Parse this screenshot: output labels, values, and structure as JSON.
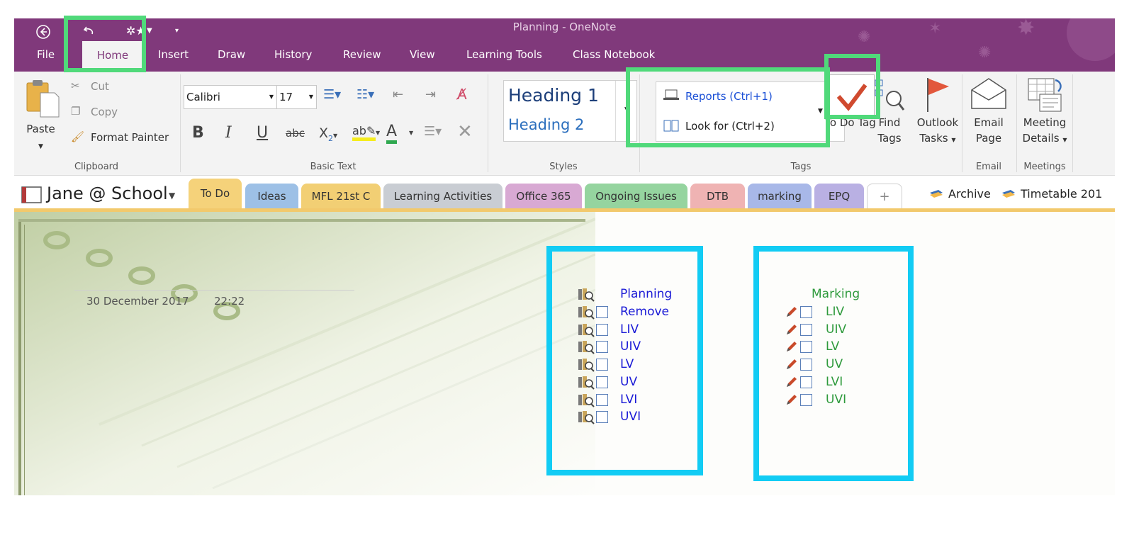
{
  "window": {
    "title": "Planning - OneNote"
  },
  "ribbon_tabs": [
    "File",
    "Home",
    "Insert",
    "Draw",
    "History",
    "Review",
    "View",
    "Learning Tools",
    "Class Notebook"
  ],
  "clipboard": {
    "paste": "Paste",
    "cut": "Cut",
    "copy": "Copy",
    "format_painter": "Format Painter",
    "group_label": "Clipboard"
  },
  "basic_text": {
    "font": "Calibri",
    "size": "17",
    "group_label": "Basic Text"
  },
  "styles": {
    "heading1": "Heading 1",
    "heading2": "Heading 2",
    "group_label": "Styles"
  },
  "tags": {
    "items": [
      {
        "label": "Reports (Ctrl+1)"
      },
      {
        "label": "Look for (Ctrl+2)"
      }
    ],
    "todo_tag": "To Do Tag",
    "find_tags": "Find Tags",
    "outlook_tasks": "Outlook Tasks",
    "group_label": "Tags"
  },
  "email": {
    "email_page": "Email Page",
    "group_label": "Email"
  },
  "meetings": {
    "meeting_details": "Meeting Details",
    "group_label": "Meetings"
  },
  "notebook": {
    "name": "Jane @ School",
    "sections": [
      {
        "label": "To Do",
        "color": "#f5d27a"
      },
      {
        "label": "Ideas",
        "color": "#9dc0e6"
      },
      {
        "label": "MFL 21st C",
        "color": "#f2cf74"
      },
      {
        "label": "Learning Activities",
        "color": "#c9cdd3"
      },
      {
        "label": "Office 365",
        "color": "#d8a9d3"
      },
      {
        "label": "Ongoing Issues",
        "color": "#95d49f"
      },
      {
        "label": "DTB",
        "color": "#efb3b3"
      },
      {
        "label": "marking",
        "color": "#a8b8e8"
      },
      {
        "label": "EPQ",
        "color": "#b9b0e3"
      }
    ],
    "add_section": "+",
    "archive": "Archive",
    "timetable": "Timetable 201"
  },
  "page": {
    "date": "30 December 2017",
    "time": "22:22",
    "planning_list": {
      "title": "Planning",
      "items": [
        "Remove",
        "LIV",
        "UIV",
        "LV",
        "UV",
        "LVI",
        "UVI"
      ]
    },
    "marking_list": {
      "title": "Marking",
      "items": [
        "LIV",
        "UIV",
        "LV",
        "UV",
        "LVI",
        "UVI"
      ]
    }
  },
  "colors": {
    "ribbon_purple": "#80397b",
    "planning_text": "#1a1ad6",
    "marking_text": "#2e9a3c",
    "highlight_green": "#50d97a",
    "highlight_blue": "#12ccf4"
  }
}
